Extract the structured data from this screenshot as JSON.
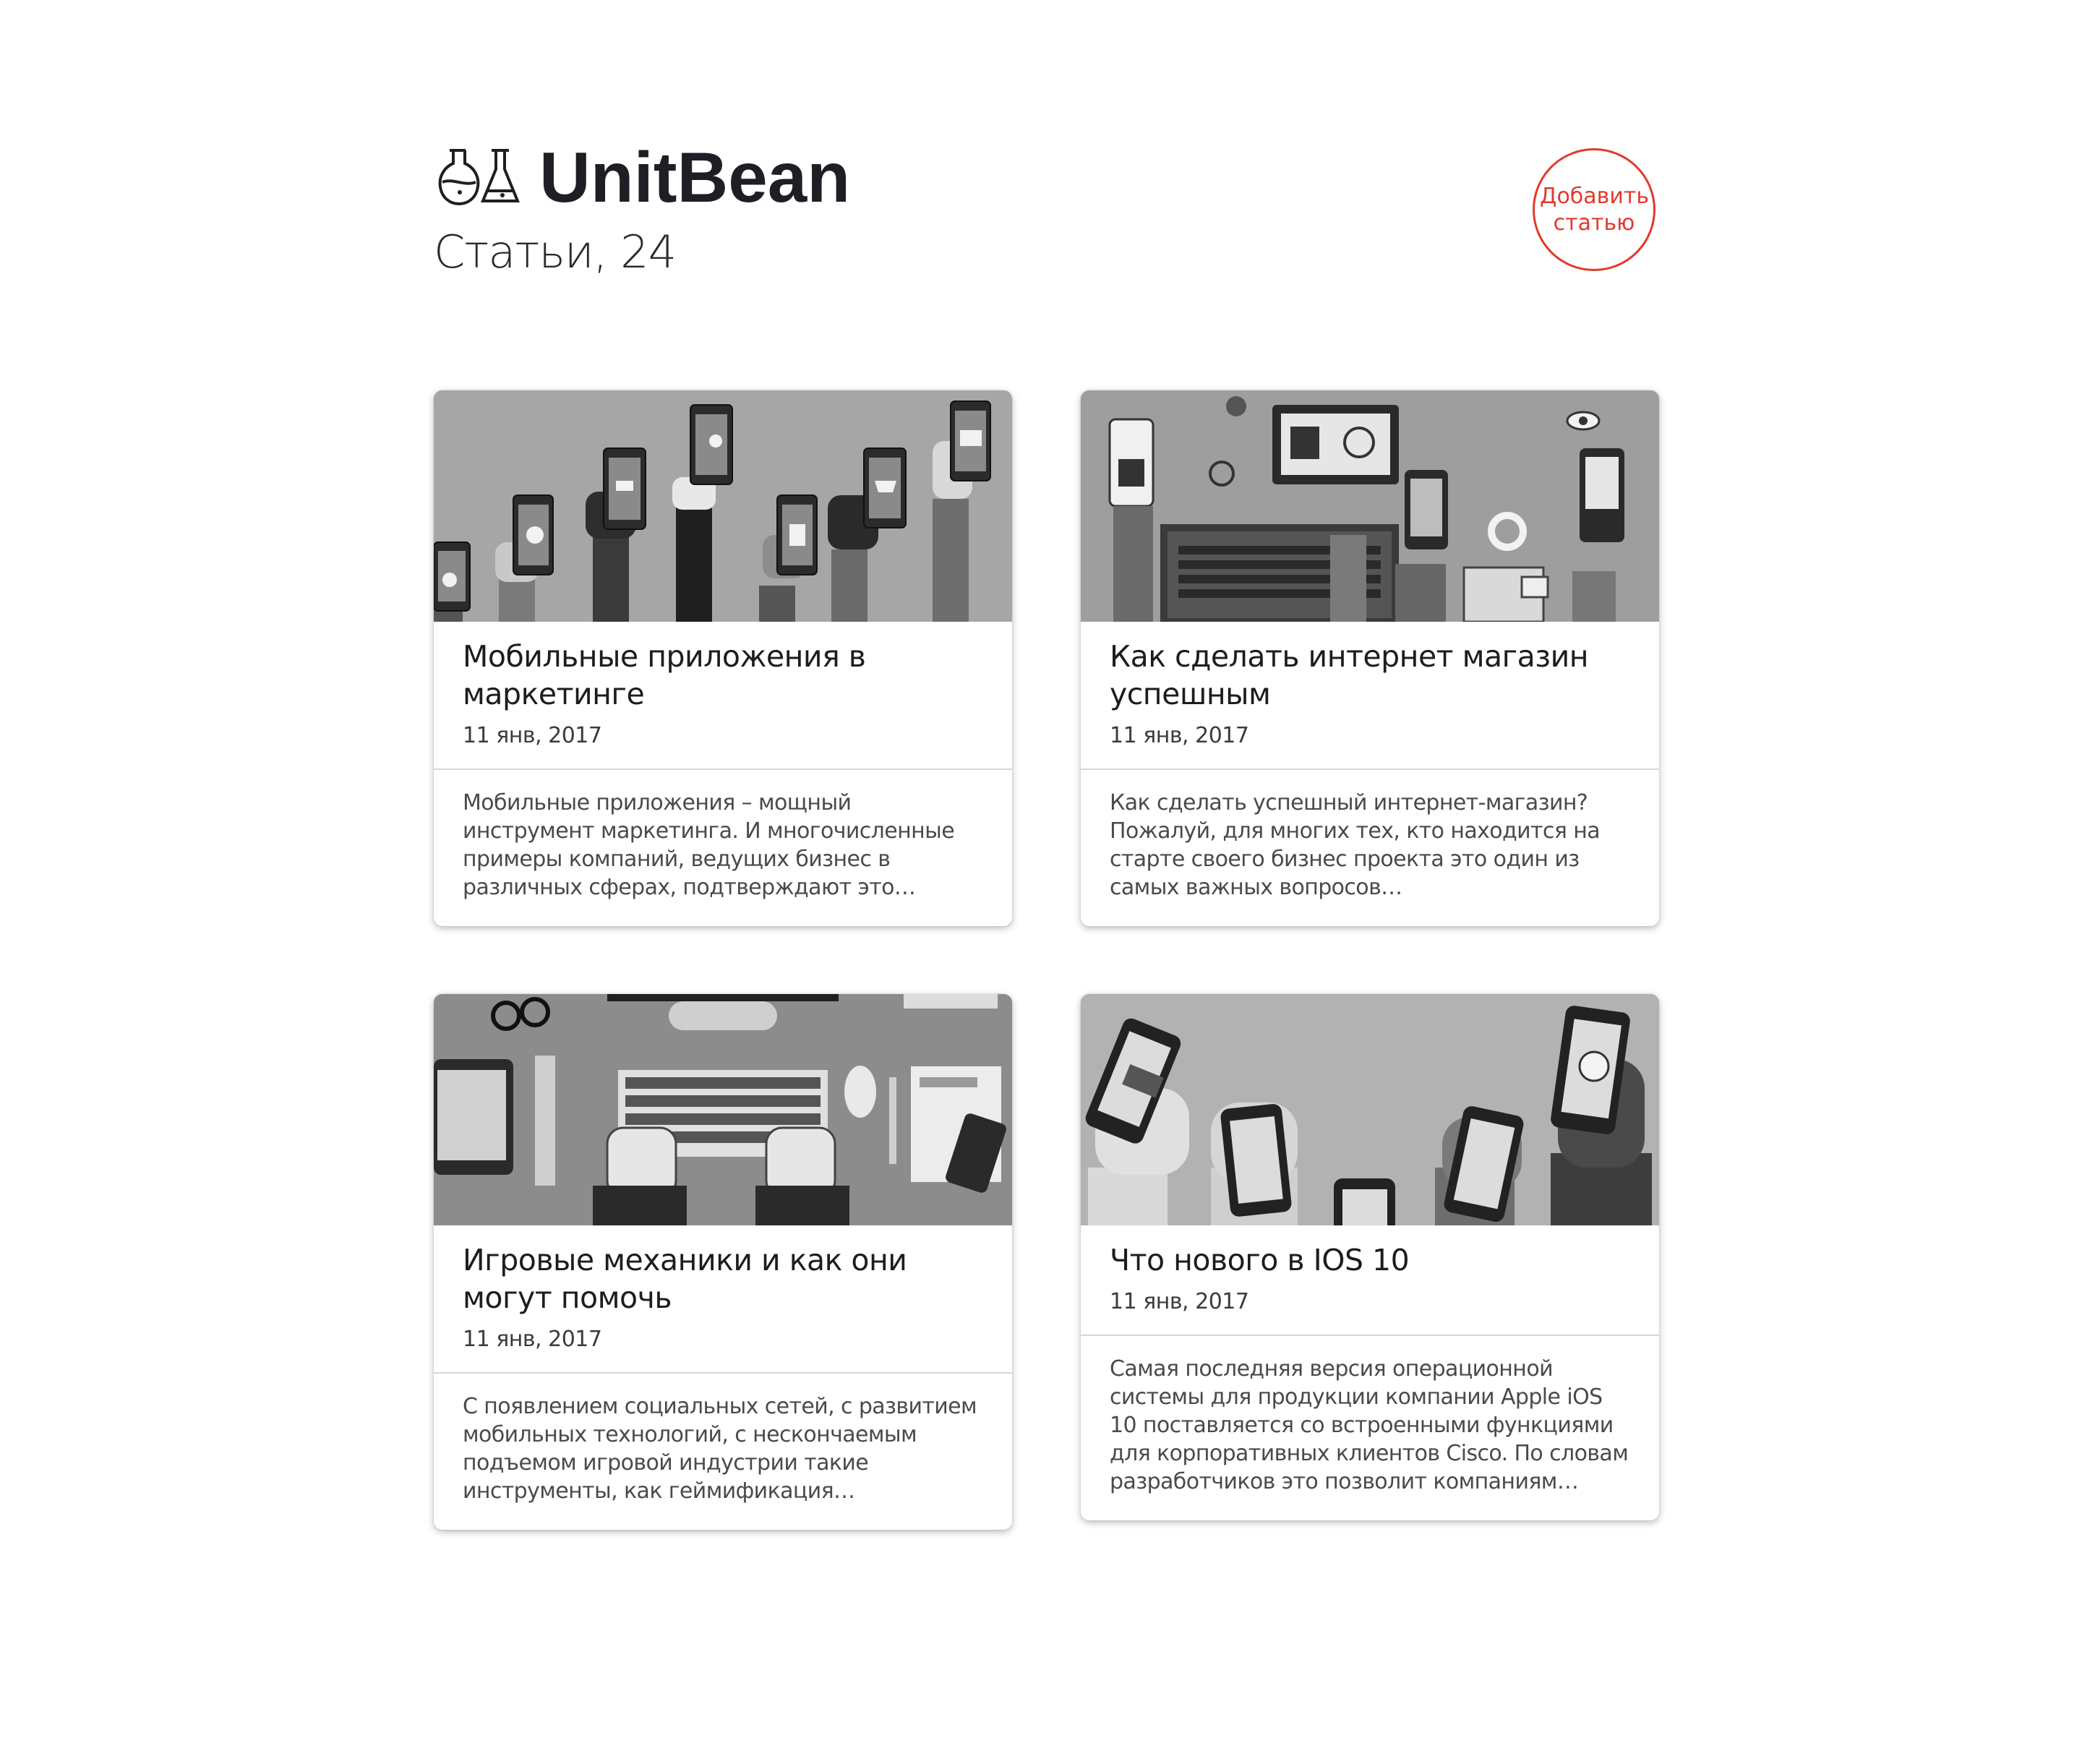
{
  "brand": {
    "name": "UnitBean"
  },
  "header": {
    "subtitle": "Статьи, 24"
  },
  "add_button": {
    "label": "Добавить статью"
  },
  "colors": {
    "accent": "#e23a2c",
    "card_image_bg": "#9a9a9a",
    "text_dark": "#1d1d1d"
  },
  "articles": [
    {
      "title": "Мобильные приложения в маркетинге",
      "date": "11 янв, 2017",
      "excerpt": "Мобильные приложения – мощный инструмент маркетинга. И многочисленные примеры компаний, ведущих бизнес в различных сферах, подтверждают это…",
      "image": "hands-holding-phones-illustration"
    },
    {
      "title": "Как сделать интернет магазин успешным",
      "date": "11 янв, 2017",
      "excerpt": "Как сделать успешный интернет-магазин? Пожалуй, для многих тех, кто находится на старте своего бизнес проекта это один из самых важных вопросов…",
      "image": "ecommerce-devices-illustration"
    },
    {
      "title": "Игровые механики и как они могут помочь",
      "date": "11 янв, 2017",
      "excerpt": "С появлением социальных сетей, с развитием мобильных технологий, с нескончаемым подъемом игровой индустрии такие инструменты, как геймификация…",
      "image": "desk-keyboard-illustration"
    },
    {
      "title": "Что нового в IOS 10",
      "date": "11 янв, 2017",
      "excerpt": "Самая последняя версия операционной системы для продукции компании Apple iOS 10 поставляется со встроенными функциями для корпоративных клиентов Cisco. По словам разработчиков это позволит компаниям…",
      "image": "hands-with-smartphones-illustration"
    }
  ]
}
